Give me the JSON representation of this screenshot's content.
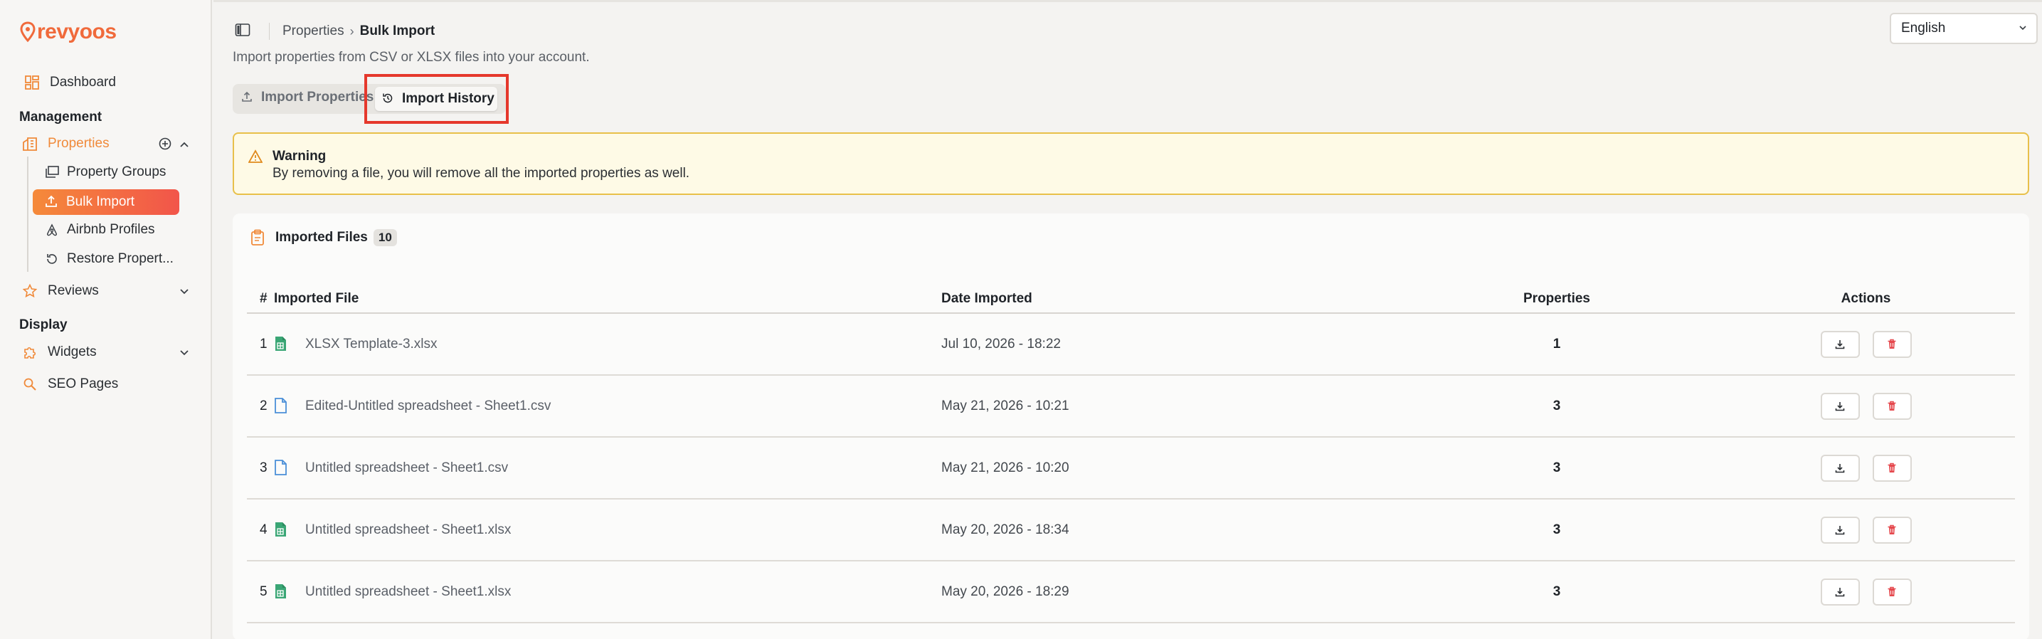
{
  "brand": {
    "name": "revyoos",
    "color": "#f06a3b"
  },
  "sidebar": {
    "dashboard": "Dashboard",
    "section_management": "Management",
    "properties": "Properties",
    "sub_items": [
      "Property Groups",
      "Bulk Import",
      "Airbnb Profiles",
      "Restore Propert..."
    ],
    "reviews": "Reviews",
    "section_display": "Display",
    "widgets": "Widgets",
    "seo_pages": "SEO Pages"
  },
  "breadcrumb": {
    "parent": "Properties",
    "current": "Bulk Import"
  },
  "language": {
    "selected": "English"
  },
  "subtitle": "Import properties from CSV or XLSX files into your account.",
  "tabs": {
    "import": "Import Properties",
    "history": "Import History"
  },
  "warning": {
    "title": "Warning",
    "text": "By removing a file, you will remove all the imported properties as well."
  },
  "imported": {
    "title": "Imported Files",
    "count": "10",
    "columns": [
      "#",
      "Imported File",
      "Date Imported",
      "Properties",
      "Actions"
    ],
    "rows": [
      {
        "num": "1",
        "file": "XLSX Template-3.xlsx",
        "type": "xlsx",
        "date": "Jul 10, 2026 - 18:22",
        "properties": "1"
      },
      {
        "num": "2",
        "file": "Edited-Untitled spreadsheet - Sheet1.csv",
        "type": "csv",
        "date": "May 21, 2026 - 10:21",
        "properties": "3"
      },
      {
        "num": "3",
        "file": "Untitled spreadsheet - Sheet1.csv",
        "type": "csv",
        "date": "May 21, 2026 - 10:20",
        "properties": "3"
      },
      {
        "num": "4",
        "file": "Untitled spreadsheet - Sheet1.xlsx",
        "type": "xlsx",
        "date": "May 20, 2026 - 18:34",
        "properties": "3"
      },
      {
        "num": "5",
        "file": "Untitled spreadsheet - Sheet1.xlsx",
        "type": "xlsx",
        "date": "May 20, 2026 - 18:29",
        "properties": "3"
      }
    ]
  },
  "colors": {
    "accent": "#f58a3a",
    "accent_end": "#f2554a",
    "warning_border": "#e8c04a",
    "highlight": "#e5382c",
    "xlsx_icon": "#3aa675",
    "csv_icon": "#4a8fd8",
    "delete": "#e5484d"
  }
}
